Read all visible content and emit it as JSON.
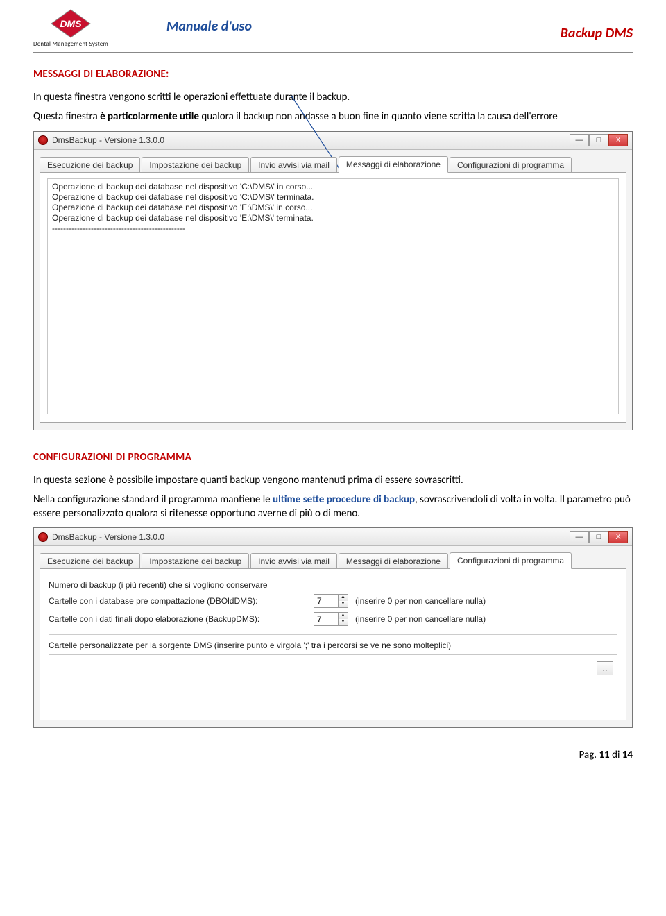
{
  "header": {
    "left_title": "Manuale d'uso",
    "right_title": "Backup DMS",
    "logo_sub": "Dental Management System",
    "logo_text": "DMS"
  },
  "section1": {
    "heading": "MESSAGGI DI ELABORAZIONE:",
    "p1_a": "In questa finestra vengono scritti le operazioni effettuate durante il backup.",
    "p2_a": "Questa finestra ",
    "p2_bold": "è particolarmente utile",
    "p2_b": " qualora il backup non andasse a buon fine in quanto viene scritta la causa dell'errore"
  },
  "section2": {
    "heading": "CONFIGURAZIONI DI PROGRAMMA",
    "p1": "In questa sezione è possibile impostare quanti backup vengono mantenuti prima di essere sovrascritti.",
    "p2_a": "Nella configurazione standard il programma mantiene le ",
    "p2_bold": "ultime sette procedure di backup",
    "p2_b": ", sovrascrivendoli di volta in volta. Il parametro può essere personalizzato qualora si ritenesse opportuno averne di più o di meno."
  },
  "window": {
    "title": "DmsBackup - Versione 1.3.0.0",
    "tabs": [
      "Esecuzione dei backup",
      "Impostazione dei backup",
      "Invio avvisi via mail",
      "Messaggi di elaborazione",
      "Configurazioni di programma"
    ],
    "log": "Operazione di backup dei database nel dispositivo 'C:\\DMS\\' in corso...\nOperazione di backup dei database nel dispositivo 'C:\\DMS\\' terminata.\nOperazione di backup dei database nel dispositivo 'E:\\DMS\\' in corso...\nOperazione di backup dei database nel dispositivo 'E:\\DMS\\' terminata.\n------------------------------------------------"
  },
  "config": {
    "label_intro": "Numero di backup (i più recenti) che si vogliono conservare",
    "row1_label": "Cartelle con i database pre compattazione (DBOldDMS):",
    "row1_value": "7",
    "hint": "(inserire 0 per non cancellare nulla)",
    "row2_label": "Cartelle con i dati finali dopo elaborazione (BackupDMS):",
    "row2_value": "7",
    "multi_label": "Cartelle personalizzate per la sorgente DMS (inserire punto e virgola ';' tra i percorsi se ve ne sono molteplici)",
    "browse": ".."
  },
  "buttons": {
    "min": "—",
    "max": "□",
    "close": "X"
  },
  "footer": {
    "pre": "Pag. ",
    "page": "11",
    "mid": " di ",
    "total": "14"
  }
}
